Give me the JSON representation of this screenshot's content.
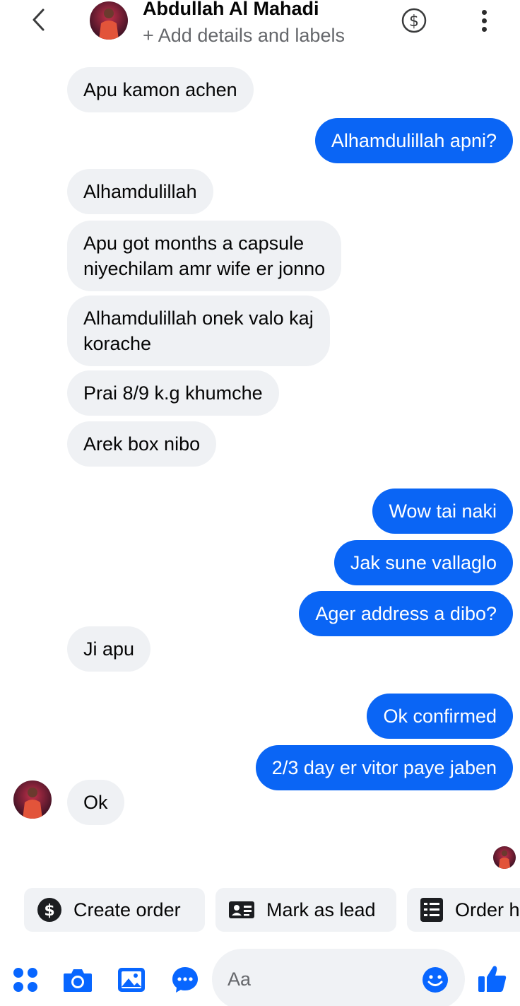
{
  "header": {
    "contact_name": "Abdullah Al Mahadi",
    "subtitle": "+ Add details and labels"
  },
  "messages": [
    {
      "side": "incoming",
      "text": "Apu kamon achen"
    },
    {
      "side": "outgoing",
      "text": "Alhamdulillah apni?"
    },
    {
      "side": "incoming",
      "text": "Alhamdulillah"
    },
    {
      "side": "incoming",
      "text": "Apu got months a capsule\nniyechilam amr wife er jonno"
    },
    {
      "side": "incoming",
      "text": "Alhamdulillah onek valo kaj\nkorache"
    },
    {
      "side": "incoming",
      "text": "Prai 8/9 k.g khumche"
    },
    {
      "side": "incoming",
      "text": "Arek box nibo"
    },
    {
      "side": "outgoing",
      "text": "Wow tai naki"
    },
    {
      "side": "outgoing",
      "text": "Jak sune vallaglo"
    },
    {
      "side": "outgoing",
      "text": "Ager address a dibo?"
    },
    {
      "side": "incoming",
      "text": "Ji apu"
    },
    {
      "side": "outgoing",
      "text": "Ok confirmed"
    },
    {
      "side": "outgoing",
      "text": "2/3 day er vitor paye jaben"
    },
    {
      "side": "incoming",
      "text": "Ok"
    }
  ],
  "quick_actions": {
    "create_order": "Create order",
    "mark_as_lead": "Mark as lead",
    "order_partial": "Order h"
  },
  "composer": {
    "placeholder": "Aa"
  },
  "colors": {
    "outgoing_bubble": "#0a65f5",
    "incoming_bubble": "#eff1f4",
    "accent": "#0866ff"
  }
}
